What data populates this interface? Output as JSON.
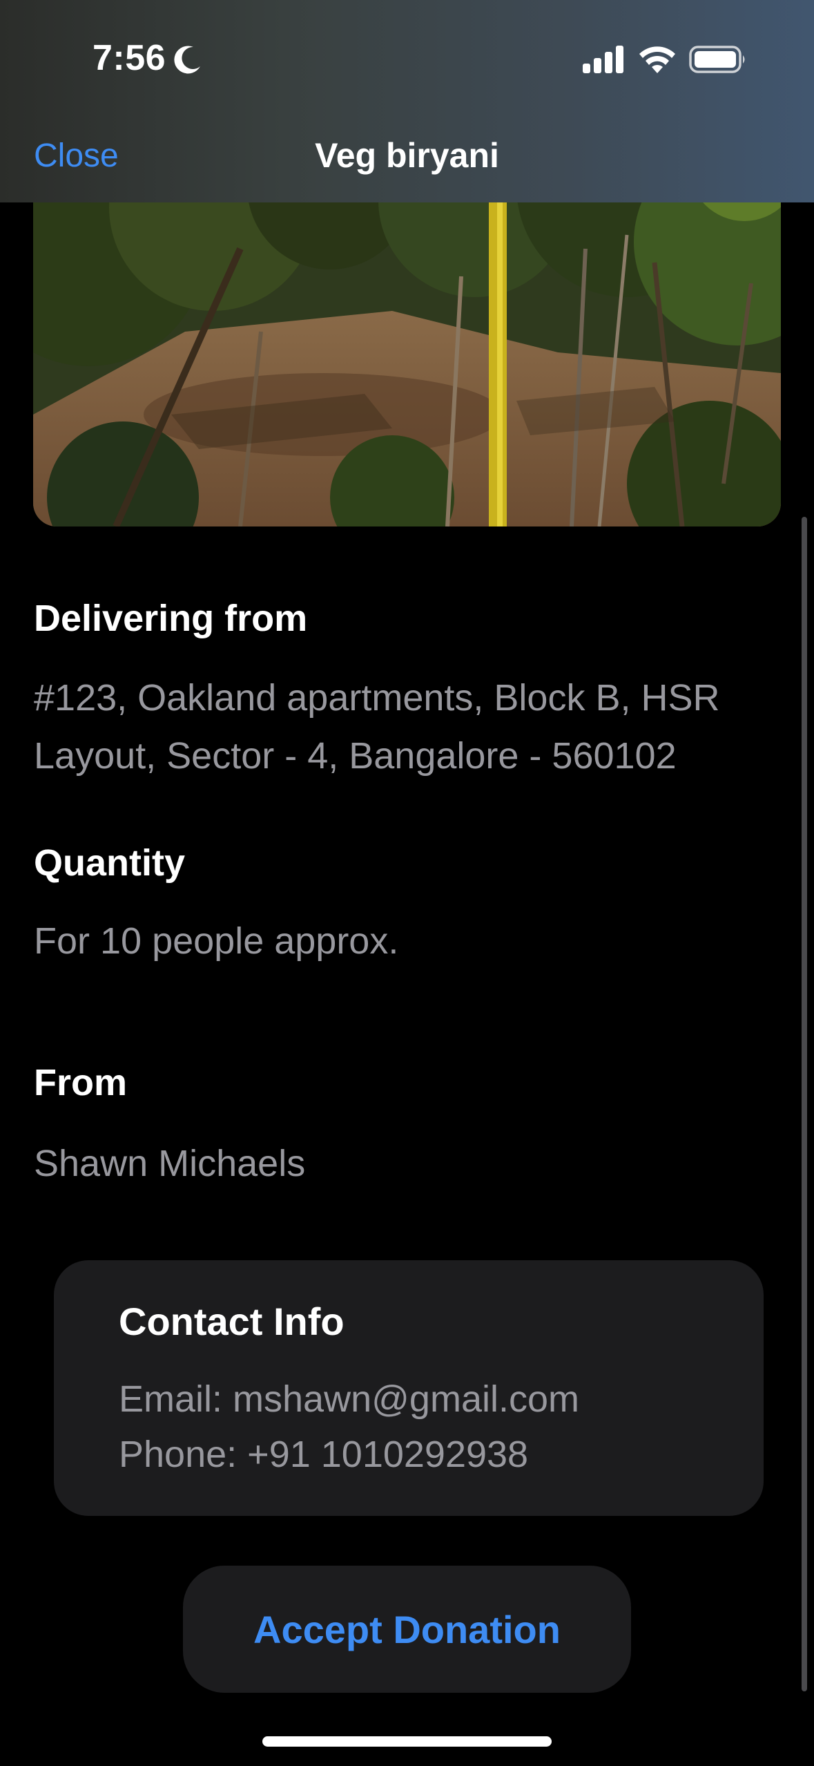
{
  "status_bar": {
    "time": "7:56",
    "focus_icon": "moon-icon",
    "icons": [
      "cellular-signal-icon",
      "wifi-icon",
      "battery-icon"
    ]
  },
  "nav": {
    "close_label": "Close",
    "title": "Veg biryani"
  },
  "photo": {
    "icon": "food-location-photo"
  },
  "delivering": {
    "heading": "Delivering from",
    "address": "#123, Oakland apartments, Block B, HSR Layout, Sector - 4, Bangalore - 560102"
  },
  "quantity": {
    "heading": "Quantity",
    "value": "For 10 people approx."
  },
  "from": {
    "heading": "From",
    "name": "Shawn Michaels"
  },
  "contact": {
    "title": "Contact Info",
    "email": "Email: mshawn@gmail.com",
    "phone": "Phone: +91 1010292938"
  },
  "actions": {
    "accept_label": "Accept Donation"
  },
  "colors": {
    "accent": "#3e8cf3",
    "background": "#000000",
    "card": "#1c1c1e",
    "secondary_text": "#98989e"
  }
}
